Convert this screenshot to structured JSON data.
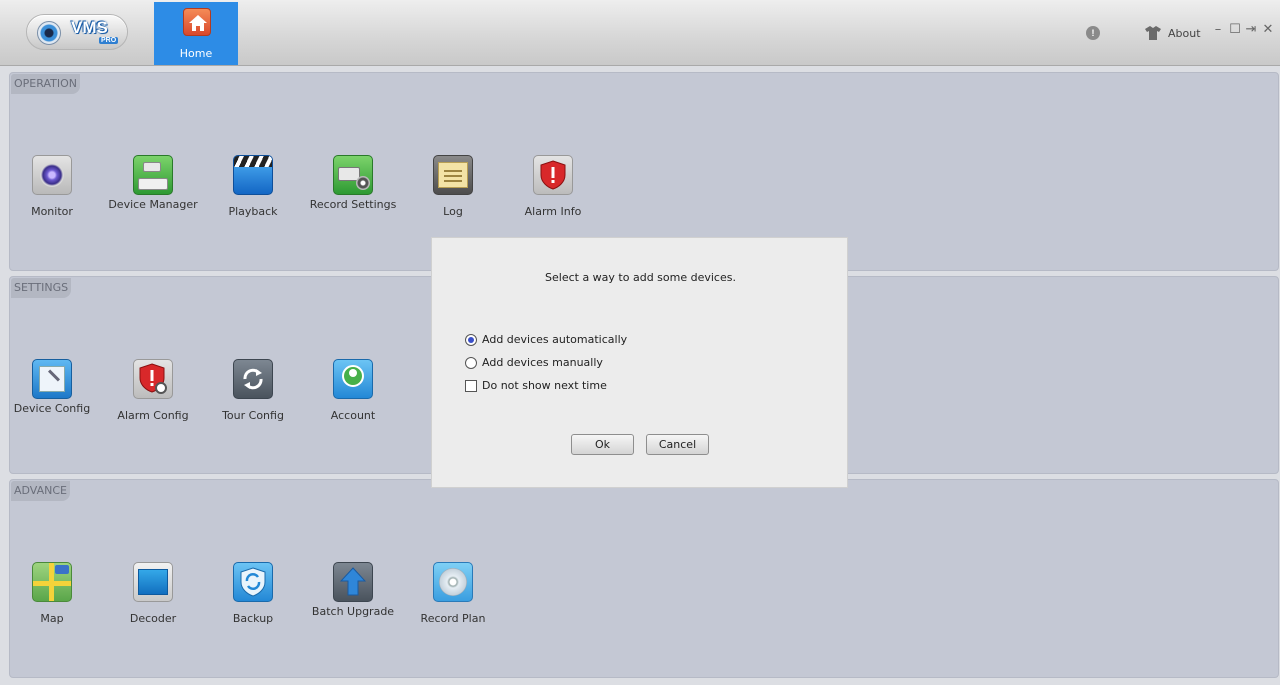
{
  "app": {
    "logo_text": "VMS",
    "logo_badge": "PRO"
  },
  "titlebar": {
    "home_label": "Home",
    "about_label": "About",
    "window_buttons": {
      "minimize": "–",
      "restore": "☐",
      "exit": "⇥",
      "close": "✕"
    }
  },
  "sections": {
    "operation": {
      "label": "OPERATION",
      "items": [
        {
          "label": "Monitor",
          "icon": "monitor-icon"
        },
        {
          "label": "Device Manager",
          "icon": "device-manager-icon"
        },
        {
          "label": "Playback",
          "icon": "playback-icon"
        },
        {
          "label": "Record Settings",
          "icon": "record-settings-icon"
        },
        {
          "label": "Log",
          "icon": "log-icon"
        },
        {
          "label": "Alarm Info",
          "icon": "alarm-info-icon"
        }
      ]
    },
    "settings": {
      "label": "SETTINGS",
      "items": [
        {
          "label": "Device Config",
          "icon": "device-config-icon"
        },
        {
          "label": "Alarm Config",
          "icon": "alarm-config-icon"
        },
        {
          "label": "Tour Config",
          "icon": "tour-config-icon"
        },
        {
          "label": "Account",
          "icon": "account-icon"
        }
      ]
    },
    "advance": {
      "label": "ADVANCE",
      "items": [
        {
          "label": "Map",
          "icon": "map-icon"
        },
        {
          "label": "Decoder",
          "icon": "decoder-icon"
        },
        {
          "label": "Backup",
          "icon": "backup-icon"
        },
        {
          "label": "Batch Upgrade",
          "icon": "batch-upgrade-icon"
        },
        {
          "label": "Record Plan",
          "icon": "record-plan-icon"
        }
      ]
    }
  },
  "dialog": {
    "message": "Select a way to add some devices.",
    "option_auto": "Add devices automatically",
    "option_manual": "Add devices manually",
    "dont_show": "Do not show next time",
    "selected": "auto",
    "ok": "Ok",
    "cancel": "Cancel"
  },
  "colors": {
    "accent": "#2d8ce6",
    "panel": "#c4c8d4"
  }
}
